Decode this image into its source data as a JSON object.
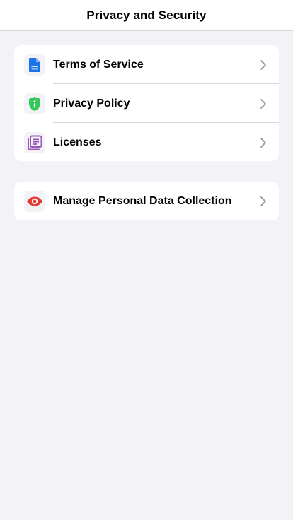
{
  "header": {
    "title": "Privacy and Security"
  },
  "section_1": {
    "items": [
      {
        "label": "Terms of Service",
        "icon": "document-icon",
        "icon_color": "#1a73e8"
      },
      {
        "label": "Privacy Policy",
        "icon": "shield-icon",
        "icon_color": "#34c759"
      },
      {
        "label": "Licenses",
        "icon": "list-icon",
        "icon_color": "#9b59b6"
      }
    ]
  },
  "section_2": {
    "items": [
      {
        "label": "Manage Personal Data Collection",
        "icon": "eye-icon",
        "icon_color": "#e53935"
      }
    ]
  }
}
